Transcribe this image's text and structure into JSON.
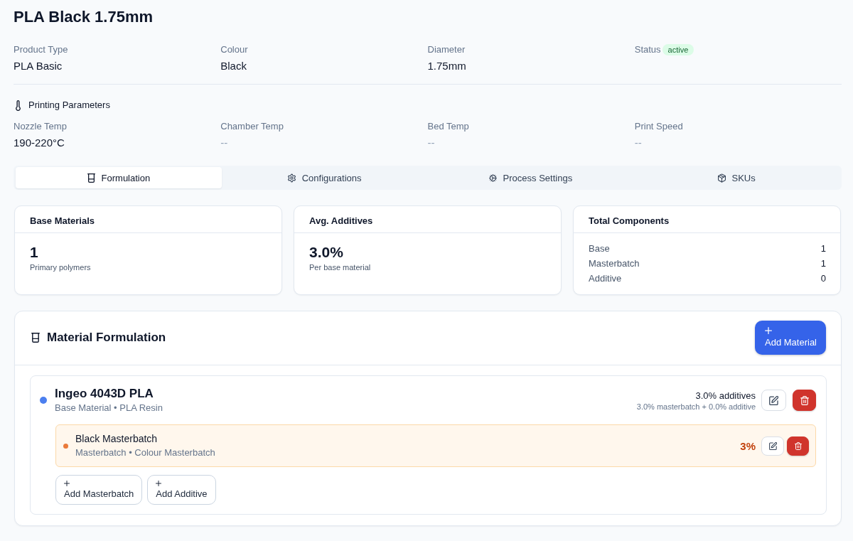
{
  "product": {
    "title": "PLA Black 1.75mm",
    "details": [
      {
        "kind": "text",
        "label": "Product Type",
        "value": "PLA Basic"
      },
      {
        "kind": "text",
        "label": "Colour",
        "value": "Black"
      },
      {
        "kind": "text",
        "label": "Diameter",
        "value": "1.75mm"
      },
      {
        "kind": "badge",
        "label": "Status",
        "value": "active"
      }
    ]
  },
  "printing_parameters": {
    "title": "Printing Parameters",
    "fields": [
      {
        "label": "Nozzle Temp",
        "value": "190-220°C",
        "empty": false
      },
      {
        "label": "Chamber Temp",
        "value": "--",
        "empty": true
      },
      {
        "label": "Bed Temp",
        "value": "--",
        "empty": true
      },
      {
        "label": "Print Speed",
        "value": "--",
        "empty": true
      }
    ]
  },
  "tabs": [
    {
      "label": "Formulation",
      "selected": true
    },
    {
      "label": "Configurations",
      "selected": false
    },
    {
      "label": "Process Settings",
      "selected": false
    },
    {
      "label": "SKUs",
      "selected": false
    }
  ],
  "summary_cards": [
    {
      "kind": "stat",
      "title": "Base Materials",
      "value": "1",
      "caption": "Primary polymers"
    },
    {
      "kind": "stat",
      "title": "Avg. Additives",
      "value": "3.0%",
      "caption": "Per base material"
    },
    {
      "kind": "breakdown",
      "title": "Total Components",
      "rows": [
        {
          "label": "Base",
          "value": "1"
        },
        {
          "label": "Masterbatch",
          "value": "1"
        },
        {
          "label": "Additive",
          "value": "0"
        }
      ]
    }
  ],
  "formulation": {
    "title": "Material Formulation",
    "add_button": "Add Material",
    "materials": [
      {
        "name": "Ingeo 4043D PLA",
        "meta": "Base Material • PLA Resin",
        "additives": "3.0% additives",
        "breakdown": "3.0% masterbatch + 0.0% additive",
        "components": [
          {
            "kind": "masterbatch",
            "name": "Black Masterbatch",
            "meta": "Masterbatch • Colour Masterbatch",
            "share": "3%"
          }
        ],
        "add_buttons": [
          "Add Masterbatch",
          "Add Additive"
        ]
      }
    ]
  }
}
